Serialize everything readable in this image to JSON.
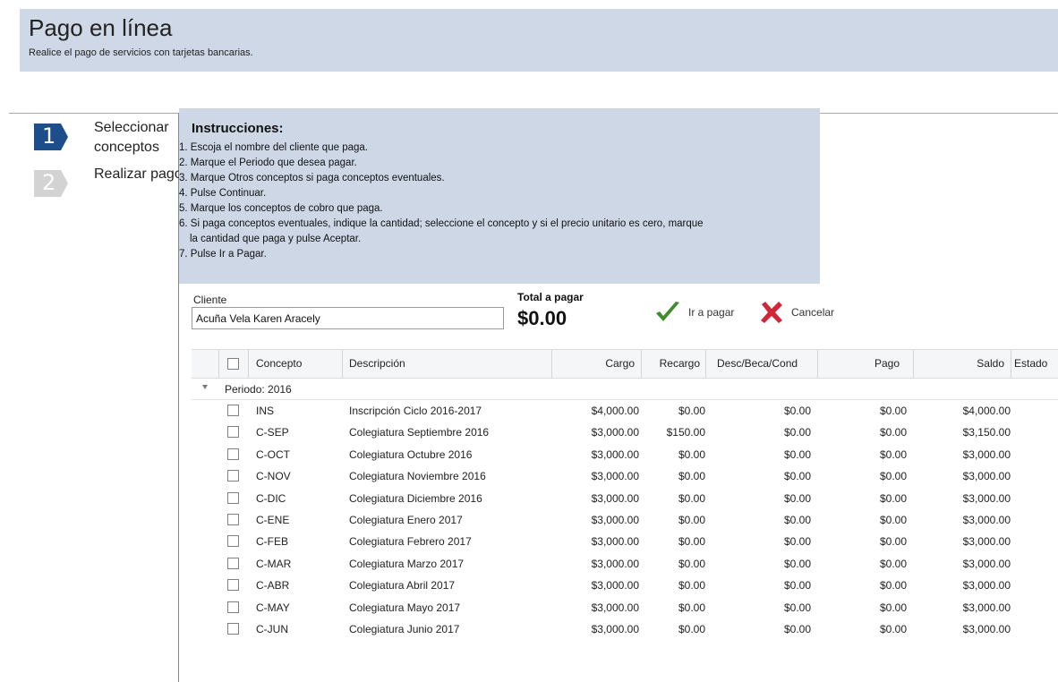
{
  "header": {
    "title": "Pago en línea",
    "subtitle": "Realice el pago de servicios con tarjetas bancarias."
  },
  "steps": [
    {
      "number": "1",
      "label": "Seleccionar conceptos",
      "active": true
    },
    {
      "number": "2",
      "label": "Realizar pago",
      "active": false
    }
  ],
  "instructions": {
    "title": "Instrucciones:",
    "lines": [
      "1. Escoja el nombre del cliente que paga.",
      "2. Marque el Periodo que desea pagar.",
      "3. Marque Otros conceptos si paga conceptos eventuales.",
      "4. Pulse Continuar.",
      "5. Marque los conceptos de cobro que paga.",
      "6. Si paga conceptos eventuales, indique la cantidad; seleccione el concepto y si el precio unitario es cero, marque",
      "la cantidad que paga y pulse Aceptar.",
      "7. Pulse Ir a Pagar."
    ]
  },
  "form": {
    "client_label": "Cliente",
    "client_value": "Acuña Vela Karen Aracely",
    "total_label": "Total a pagar",
    "total_value": "$0.00"
  },
  "actions": {
    "pay_label": "Ir a pagar",
    "cancel_label": "Cancelar"
  },
  "colors": {
    "header_bg": "#cfd8e6",
    "step_active": "#1e4d8c",
    "step_inactive": "#d3d3d3",
    "pay_icon": "#3f8b2e",
    "cancel_icon": "#d0263a"
  },
  "table": {
    "columns": [
      "Concepto",
      "Descripción",
      "Cargo",
      "Recargo",
      "Desc/Beca/Cond",
      "Pago",
      "Saldo",
      "Estado"
    ],
    "group_label": "Periodo: 2016",
    "rows": [
      {
        "concepto": "INS",
        "descripcion": "Inscripción Ciclo 2016-2017",
        "cargo": "$4,000.00",
        "recargo": "$0.00",
        "desc": "$0.00",
        "pago": "$0.00",
        "saldo": "$4,000.00"
      },
      {
        "concepto": "C-SEP",
        "descripcion": "Colegiatura Septiembre 2016",
        "cargo": "$3,000.00",
        "recargo": "$150.00",
        "desc": "$0.00",
        "pago": "$0.00",
        "saldo": "$3,150.00"
      },
      {
        "concepto": "C-OCT",
        "descripcion": "Colegiatura Octubre 2016",
        "cargo": "$3,000.00",
        "recargo": "$0.00",
        "desc": "$0.00",
        "pago": "$0.00",
        "saldo": "$3,000.00"
      },
      {
        "concepto": "C-NOV",
        "descripcion": "Colegiatura Noviembre 2016",
        "cargo": "$3,000.00",
        "recargo": "$0.00",
        "desc": "$0.00",
        "pago": "$0.00",
        "saldo": "$3,000.00"
      },
      {
        "concepto": "C-DIC",
        "descripcion": "Colegiatura Diciembre 2016",
        "cargo": "$3,000.00",
        "recargo": "$0.00",
        "desc": "$0.00",
        "pago": "$0.00",
        "saldo": "$3,000.00"
      },
      {
        "concepto": "C-ENE",
        "descripcion": "Colegiatura Enero 2017",
        "cargo": "$3,000.00",
        "recargo": "$0.00",
        "desc": "$0.00",
        "pago": "$0.00",
        "saldo": "$3,000.00"
      },
      {
        "concepto": "C-FEB",
        "descripcion": "Colegiatura Febrero 2017",
        "cargo": "$3,000.00",
        "recargo": "$0.00",
        "desc": "$0.00",
        "pago": "$0.00",
        "saldo": "$3,000.00"
      },
      {
        "concepto": "C-MAR",
        "descripcion": "Colegiatura Marzo 2017",
        "cargo": "$3,000.00",
        "recargo": "$0.00",
        "desc": "$0.00",
        "pago": "$0.00",
        "saldo": "$3,000.00"
      },
      {
        "concepto": "C-ABR",
        "descripcion": "Colegiatura Abril 2017",
        "cargo": "$3,000.00",
        "recargo": "$0.00",
        "desc": "$0.00",
        "pago": "$0.00",
        "saldo": "$3,000.00"
      },
      {
        "concepto": "C-MAY",
        "descripcion": "Colegiatura Mayo 2017",
        "cargo": "$3,000.00",
        "recargo": "$0.00",
        "desc": "$0.00",
        "pago": "$0.00",
        "saldo": "$3,000.00"
      },
      {
        "concepto": "C-JUN",
        "descripcion": "Colegiatura Junio 2017",
        "cargo": "$3,000.00",
        "recargo": "$0.00",
        "desc": "$0.00",
        "pago": "$0.00",
        "saldo": "$3,000.00"
      }
    ]
  }
}
